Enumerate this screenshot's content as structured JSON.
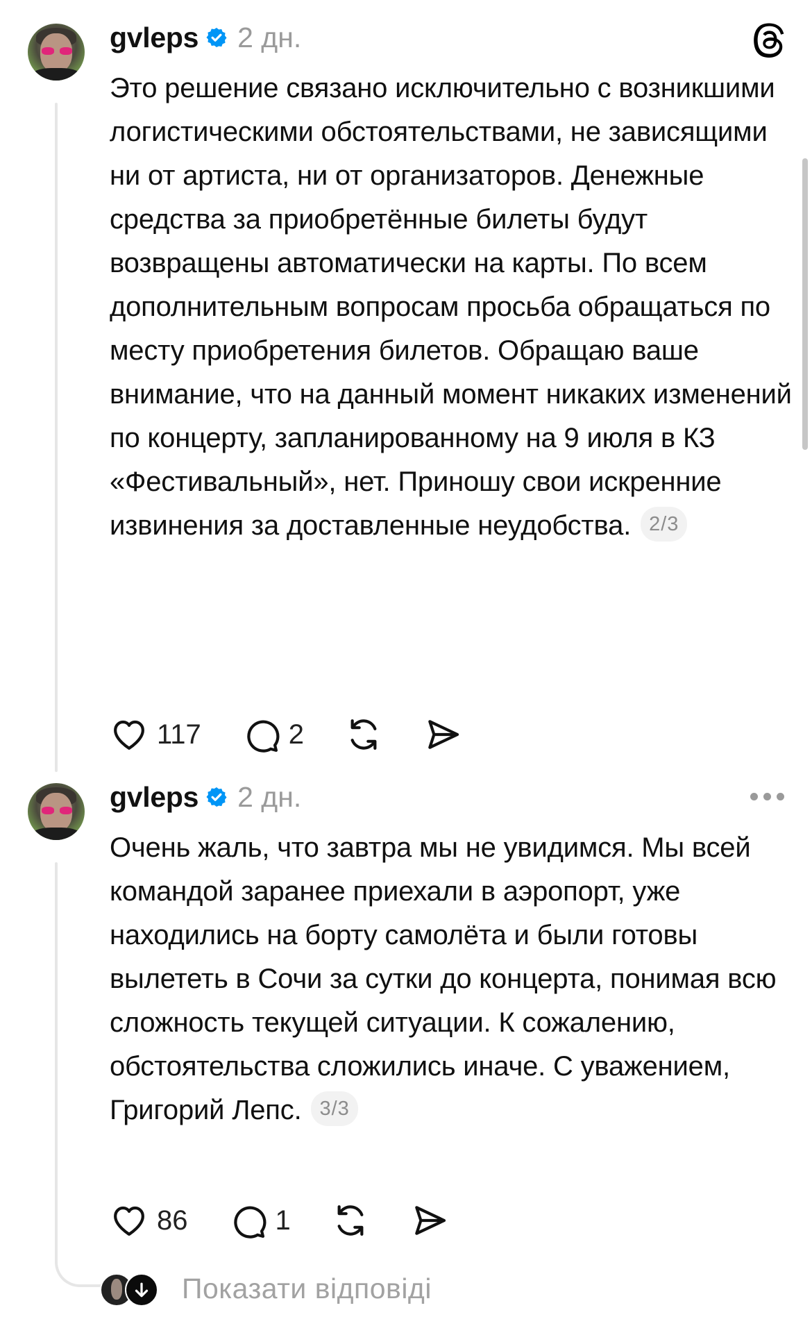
{
  "posts": [
    {
      "username": "gvleps",
      "time": "2 дн.",
      "text": "Это решение связано исключительно с возникшими логистическими обстоятельствами, не зависящими ни от артиста, ни от организаторов. Денежные средства за приобретённые билеты будут возвращены автоматически на карты. По всем дополнительным вопросам просьба обращаться по месту приобретения билетов. Обращаю ваше внимание, что на данный момент никаких изменений по концерту, запланированному на 9 июля в КЗ «Фестивальный», нет. Приношу свои искренние извинения за доставленные неудобства.",
      "pager": "2/3",
      "likes": "117",
      "comments": "2"
    },
    {
      "username": "gvleps",
      "time": "2 дн.",
      "text": "Очень жаль, что завтра мы не увидимся. Мы всей командой заранее приехали в аэропорт, уже находились на борту самолёта и были готовы вылететь в Сочи за сутки до концерта, понимая всю сложность текущей ситуации. К сожалению, обстоятельства сложились иначе. С уважением, Григорий Лепс.",
      "pager": "3/3",
      "likes": "86",
      "comments": "1"
    }
  ],
  "replies_label": "Показати відповіді",
  "colors": {
    "verified": "#0095f6",
    "muted": "#9a9a9a",
    "accent_glasses": "#e0267a"
  },
  "icons": [
    "threads-logo-icon",
    "verified-icon",
    "heart-icon",
    "comment-icon",
    "repost-icon",
    "share-icon",
    "more-icon",
    "arrow-down-icon"
  ]
}
